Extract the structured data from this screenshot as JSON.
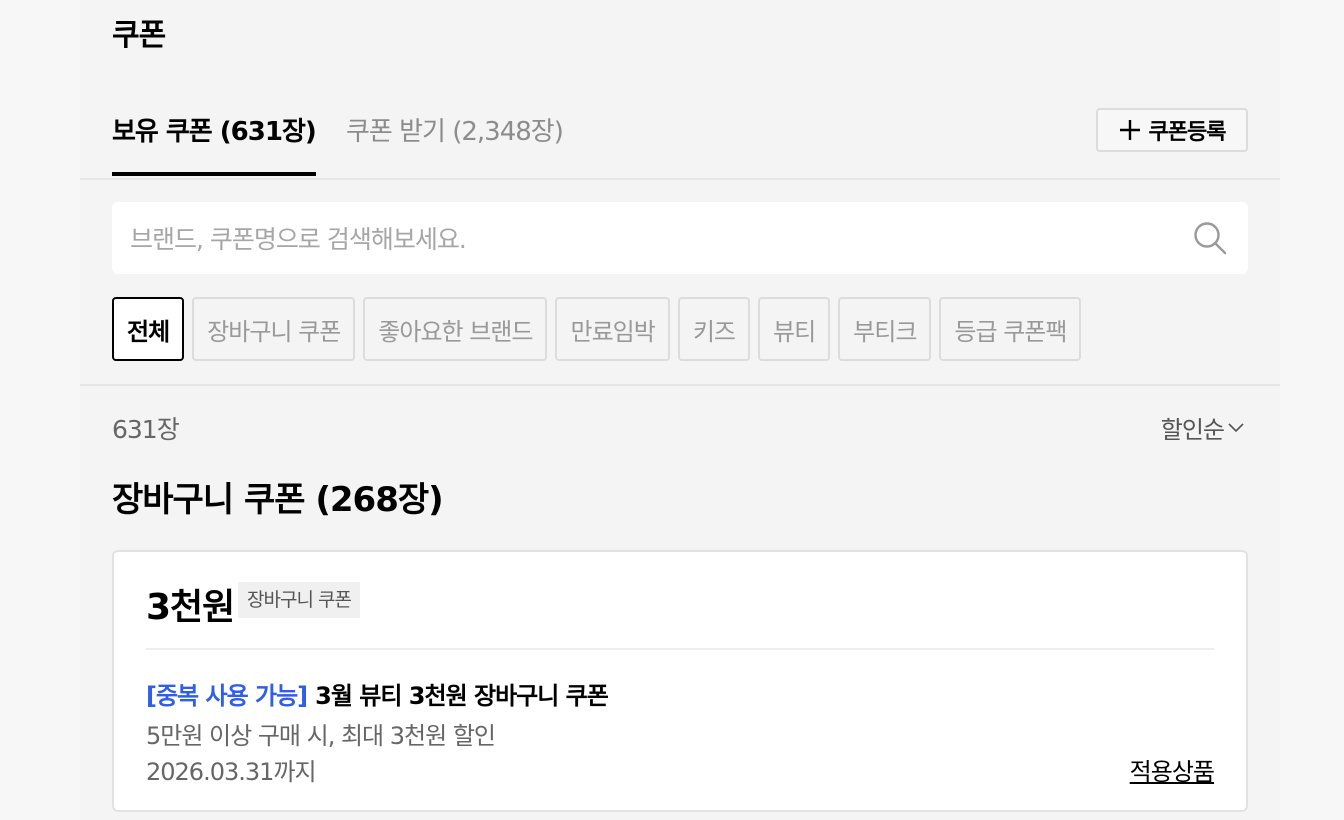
{
  "page": {
    "title": "쿠폰"
  },
  "tabs": [
    {
      "label": "보유 쿠폰 (631장)",
      "active": true
    },
    {
      "label": "쿠폰 받기 (2,348장)",
      "active": false
    }
  ],
  "register_button": {
    "label": "쿠폰등록",
    "icon": "plus-icon"
  },
  "search": {
    "placeholder": "브랜드, 쿠폰명으로 검색해보세요.",
    "value": "",
    "icon": "search-icon"
  },
  "filters": [
    {
      "label": "전체",
      "active": true
    },
    {
      "label": "장바구니 쿠폰",
      "active": false
    },
    {
      "label": "좋아요한 브랜드",
      "active": false
    },
    {
      "label": "만료임박",
      "active": false
    },
    {
      "label": "키즈",
      "active": false
    },
    {
      "label": "뷰티",
      "active": false
    },
    {
      "label": "부티크",
      "active": false
    },
    {
      "label": "등급 쿠폰팩",
      "active": false
    }
  ],
  "list": {
    "count": "631장",
    "sort_label": "할인순",
    "sort_icon": "chevron-down-icon",
    "section_title": "장바구니 쿠폰 (268장)"
  },
  "coupon": {
    "amount": "3천원",
    "type": "장바구니 쿠폰",
    "tag": "[중복 사용 가능]",
    "name": "3월 뷰티 3천원 장바구니 쿠폰",
    "condition": "5만원 이상 구매 시, 최대 3천원 할인",
    "expiry": "2026.03.31까지",
    "apply_link": "적용상품"
  },
  "colors": {
    "accent_blue": "#2f5fe6",
    "panel_bg": "#f4f4f4",
    "card_bg": "#ffffff"
  }
}
